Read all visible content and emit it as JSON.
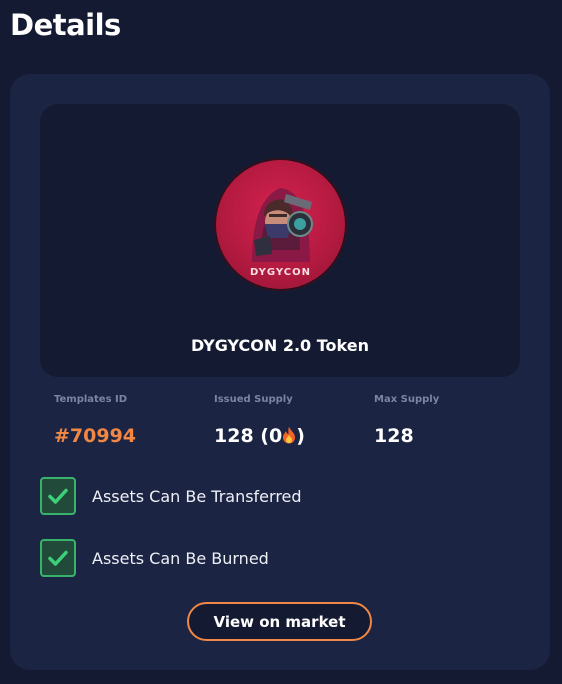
{
  "page": {
    "title": "Details"
  },
  "token": {
    "name": "DYGYCON 2.0 Token",
    "image_text": "DYGYCON",
    "image_colors": {
      "primary": "#d4234f",
      "dark": "#8e1534"
    }
  },
  "stats": [
    {
      "label": "Templates ID",
      "value": "#70994",
      "value_color": "#f08745"
    },
    {
      "label": "Issued Supply",
      "value": "128 (0",
      "value_suffix": ")",
      "icon": "fire-icon"
    },
    {
      "label": "Max Supply",
      "value": "128"
    }
  ],
  "checks": [
    {
      "label": "Assets Can Be Transferred",
      "checked": true
    },
    {
      "label": "Assets Can Be Burned",
      "checked": true
    }
  ],
  "actions": {
    "view_market": "View on market"
  },
  "colors": {
    "accent": "#f08745",
    "success": "#39b26b",
    "card": "#1c2444",
    "background": "#151a33"
  }
}
